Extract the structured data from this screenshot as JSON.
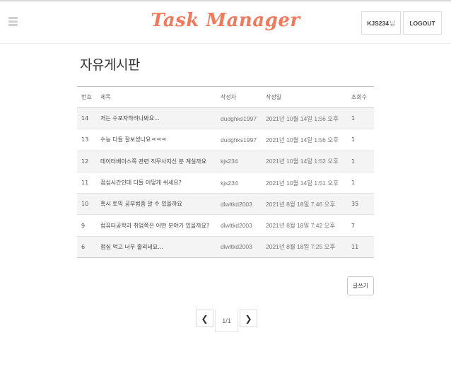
{
  "header": {
    "logo": "Task Manager",
    "user_name": "KJS234",
    "user_suffix": "님",
    "logout_label": "LOGOUT",
    "menu_icon": "hamburger-menu-icon"
  },
  "board": {
    "title": "자유게시판",
    "columns": [
      "번호",
      "제목",
      "작성자",
      "작성일",
      "조회수"
    ],
    "rows": [
      {
        "no": "14",
        "title": "저는 수포자하려나봐요...",
        "author": "dudghks1997",
        "date": "2021년 10월 14일 1:56 오후",
        "views": "1"
      },
      {
        "no": "13",
        "title": "수능 다들 잘보셨나요ㅋㅋㅋ",
        "author": "dudghks1997",
        "date": "2021년 10월 14일 1:56 오후",
        "views": "1"
      },
      {
        "no": "12",
        "title": "데이터베이스쪽 관련 직무사지신 분 계실까요",
        "author": "kjs234",
        "date": "2021년 10월 14일 1:52 오후",
        "views": "1"
      },
      {
        "no": "11",
        "title": "점심시간인데 다들 어떻게 쉬세요?",
        "author": "kjs234",
        "date": "2021년 10월 14일 1:51 오후",
        "views": "1"
      },
      {
        "no": "10",
        "title": "혹시 토익 공부법좀 알 수 있을까요",
        "author": "dlwltkd2003",
        "date": "2021년 8월 18일 7:46 오후",
        "views": "35"
      },
      {
        "no": "9",
        "title": "컴퓨터공학과 취업쪽은 어떤 분야가 있을까요?",
        "author": "dlwltkd2003",
        "date": "2021년 8월 18일 7:42 오후",
        "views": "7"
      },
      {
        "no": "6",
        "title": "점심 먹고 너무 졸리네요...",
        "author": "dlwltkd2003",
        "date": "2021년 8월 18일 7:25 오후",
        "views": "11"
      }
    ],
    "write_label": "글쓰기"
  },
  "pagination": {
    "prev_symbol": "❮",
    "next_symbol": "❯",
    "page_info": "1/1"
  }
}
